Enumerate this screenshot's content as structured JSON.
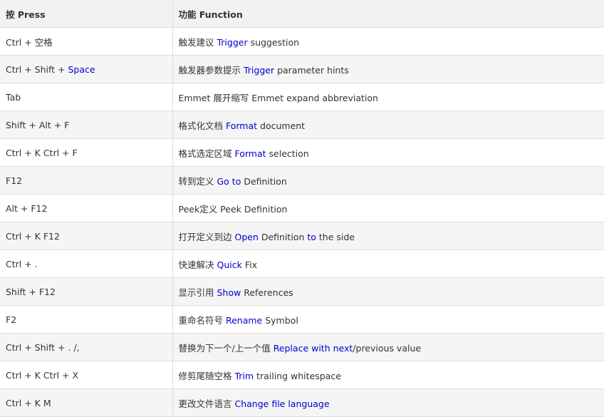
{
  "header": {
    "press": "按 Press",
    "function": "功能 Function"
  },
  "colors": {
    "keyword": "#0000cc",
    "text": "#333333",
    "border": "#dddddd",
    "header_bg": "#f2f2f2",
    "stripe_bg": "#f5f5f5"
  },
  "rows": [
    {
      "press": [
        {
          "t": "Ctrl + 空格"
        }
      ],
      "func": [
        {
          "t": "触发建议 "
        },
        {
          "t": "Trigger",
          "k": true
        },
        {
          "t": " suggestion"
        }
      ]
    },
    {
      "press": [
        {
          "t": "Ctrl + Shift + "
        },
        {
          "t": "Space",
          "k": true
        }
      ],
      "func": [
        {
          "t": "触发器参数提示 "
        },
        {
          "t": "Trigger",
          "k": true
        },
        {
          "t": " parameter hints"
        }
      ]
    },
    {
      "press": [
        {
          "t": "Tab"
        }
      ],
      "func": [
        {
          "t": "Emmet 展开缩写 Emmet expand abbreviation"
        }
      ]
    },
    {
      "press": [
        {
          "t": "Shift + Alt + F"
        }
      ],
      "func": [
        {
          "t": "格式化文档 "
        },
        {
          "t": "Format",
          "k": true
        },
        {
          "t": " document"
        }
      ]
    },
    {
      "press": [
        {
          "t": "Ctrl + K Ctrl + F"
        }
      ],
      "func": [
        {
          "t": "格式选定区域 "
        },
        {
          "t": "Format",
          "k": true
        },
        {
          "t": " selection"
        }
      ]
    },
    {
      "press": [
        {
          "t": "F12"
        }
      ],
      "func": [
        {
          "t": "转到定义 "
        },
        {
          "t": "Go to",
          "k": true
        },
        {
          "t": " Definition"
        }
      ]
    },
    {
      "press": [
        {
          "t": "Alt + F12"
        }
      ],
      "func": [
        {
          "t": "Peek定义 Peek Definition"
        }
      ]
    },
    {
      "press": [
        {
          "t": "Ctrl + K F12"
        }
      ],
      "func": [
        {
          "t": "打开定义到边 "
        },
        {
          "t": "Open",
          "k": true
        },
        {
          "t": " Definition "
        },
        {
          "t": "to",
          "k": true
        },
        {
          "t": " the side"
        }
      ]
    },
    {
      "press": [
        {
          "t": "Ctrl + ."
        }
      ],
      "func": [
        {
          "t": "快速解决 "
        },
        {
          "t": "Quick",
          "k": true
        },
        {
          "t": " Fix"
        }
      ]
    },
    {
      "press": [
        {
          "t": "Shift + F12"
        }
      ],
      "func": [
        {
          "t": "显示引用 "
        },
        {
          "t": "Show",
          "k": true
        },
        {
          "t": " References"
        }
      ]
    },
    {
      "press": [
        {
          "t": "F2"
        }
      ],
      "func": [
        {
          "t": "重命名符号 "
        },
        {
          "t": "Rename",
          "k": true
        },
        {
          "t": " Symbol"
        }
      ]
    },
    {
      "press": [
        {
          "t": "Ctrl + Shift + . /,"
        }
      ],
      "func": [
        {
          "t": "替换为下一个/上一个值 "
        },
        {
          "t": "Replace with next",
          "k": true
        },
        {
          "t": "/previous value"
        }
      ]
    },
    {
      "press": [
        {
          "t": "Ctrl + K Ctrl + X"
        }
      ],
      "func": [
        {
          "t": "修剪尾随空格 "
        },
        {
          "t": "Trim",
          "k": true
        },
        {
          "t": " trailing whitespace"
        }
      ]
    },
    {
      "press": [
        {
          "t": "Ctrl + K M"
        }
      ],
      "func": [
        {
          "t": "更改文件语言 "
        },
        {
          "t": "Change file language",
          "k": true
        }
      ]
    }
  ]
}
